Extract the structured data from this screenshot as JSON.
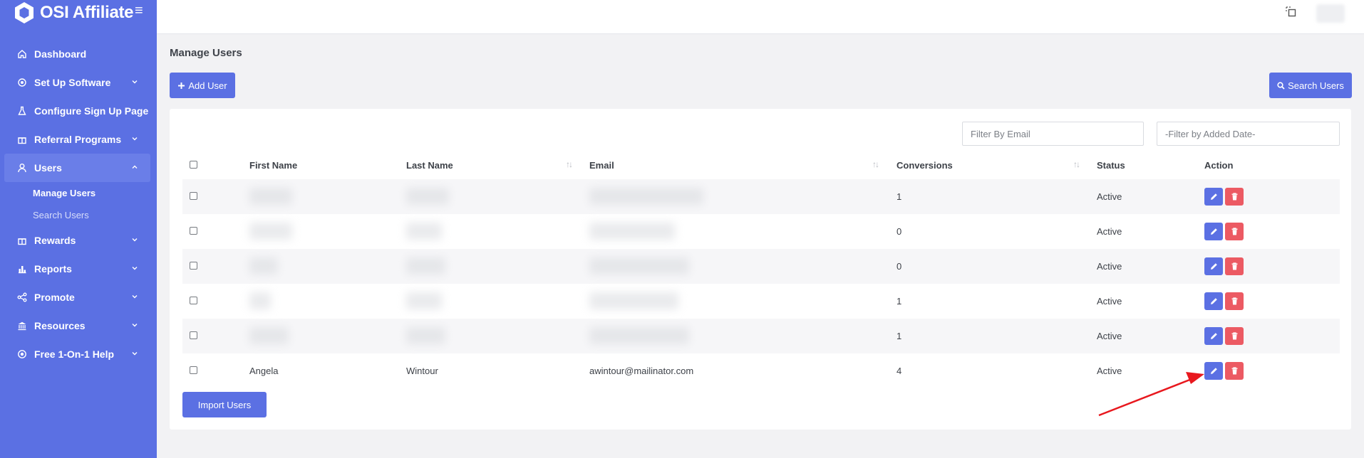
{
  "app": {
    "name": "OSI Affiliate",
    "menu_icon": "hamburger-icon"
  },
  "sidebar": {
    "items": [
      {
        "label": "Dashboard",
        "icon": "home-icon"
      },
      {
        "label": "Set Up Software",
        "icon": "settings-icon",
        "has_children": true
      },
      {
        "label": "Configure Sign Up Page",
        "icon": "flask-icon"
      },
      {
        "label": "Referral Programs",
        "icon": "gift-icon",
        "has_children": true
      },
      {
        "label": "Users",
        "icon": "user-icon",
        "expanded": true,
        "active": true,
        "children": [
          {
            "label": "Manage Users",
            "current": true
          },
          {
            "label": "Search Users"
          }
        ]
      },
      {
        "label": "Rewards",
        "icon": "gift-icon",
        "has_children": true
      },
      {
        "label": "Reports",
        "icon": "bar-chart-icon",
        "has_children": true
      },
      {
        "label": "Promote",
        "icon": "share-icon",
        "has_children": true
      },
      {
        "label": "Resources",
        "icon": "bank-icon",
        "has_children": true
      },
      {
        "label": "Free 1-On-1 Help",
        "icon": "help-icon",
        "has_children": true
      }
    ]
  },
  "topbar": {
    "fullscreen_icon": "fullscreen-icon"
  },
  "page": {
    "title": "Manage Users",
    "add_user_label": "Add User",
    "search_users_label": "Search Users",
    "import_users_label": "Import Users"
  },
  "filters": {
    "email_placeholder": "Filter By Email",
    "date_placeholder": "-Filter by Added Date-"
  },
  "table": {
    "columns": [
      "First Name",
      "Last Name",
      "Email",
      "Conversions",
      "Status",
      "Action"
    ],
    "rows": [
      {
        "first_name": "",
        "last_name": "",
        "email": "",
        "conversions": "1",
        "status": "Active",
        "blurred": true
      },
      {
        "first_name": "",
        "last_name": "",
        "email": "",
        "conversions": "0",
        "status": "Active",
        "blurred": true
      },
      {
        "first_name": "",
        "last_name": "",
        "email": "",
        "conversions": "0",
        "status": "Active",
        "blurred": true
      },
      {
        "first_name": "",
        "last_name": "",
        "email": "",
        "conversions": "1",
        "status": "Active",
        "blurred": true
      },
      {
        "first_name": "",
        "last_name": "",
        "email": "",
        "conversions": "1",
        "status": "Active",
        "blurred": true
      },
      {
        "first_name": "Angela",
        "last_name": "Wintour",
        "email": "awintour@mailinator.com",
        "conversions": "4",
        "status": "Active",
        "blurred": false
      }
    ]
  },
  "colors": {
    "sidebar": "#5b70e3",
    "primary": "#5b70e3",
    "danger": "#ec5a63",
    "annotation_arrow": "#e8181e"
  }
}
